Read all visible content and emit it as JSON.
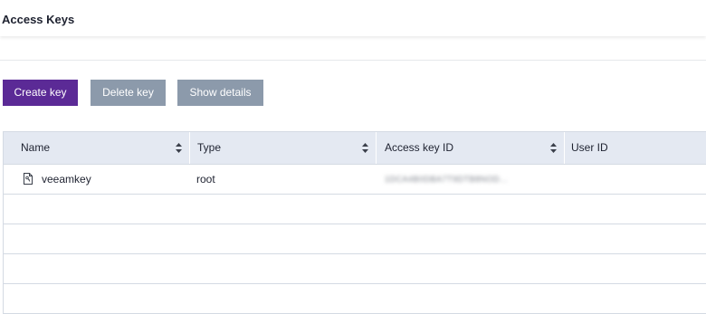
{
  "header": {
    "title": "Access Keys"
  },
  "toolbar": {
    "create_label": "Create key",
    "delete_label": "Delete key",
    "details_label": "Show details"
  },
  "table": {
    "columns": [
      {
        "label": "Name",
        "sortable": true
      },
      {
        "label": "Type",
        "sortable": true
      },
      {
        "label": "Access key ID",
        "sortable": true
      },
      {
        "label": "User ID",
        "sortable": false
      }
    ],
    "rows": [
      {
        "name": "veeamkey",
        "type": "root",
        "access_key_id": "1DCA4B0DBA7T9DTB8NOD...",
        "user_id": ""
      }
    ]
  },
  "colors": {
    "primary_button": "#5b2a96",
    "disabled_button": "#8c9aab",
    "table_header": "#e4e9f2"
  },
  "icons": {
    "sort": "sort-updown-icon",
    "row_key": "key-file-icon"
  }
}
